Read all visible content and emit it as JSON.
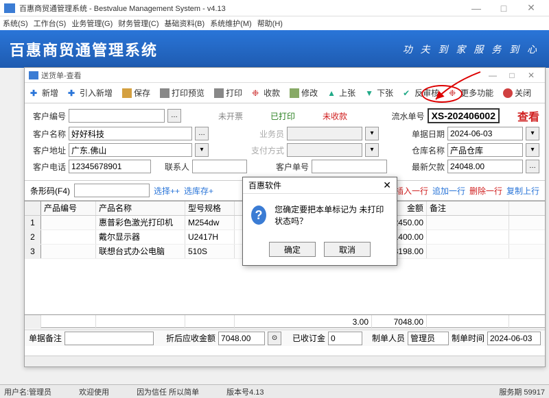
{
  "app": {
    "title": "百惠商贸通管理系统 - Bestvalue Management System - v4.13",
    "banner_title": "百惠商贸通管理系统",
    "slogan": "功 夫 到 家  服 务 到 心"
  },
  "menus": [
    "系统(S)",
    "工作台(S)",
    "业务管理(G)",
    "财务管理(C)",
    "基础资料(B)",
    "系统维护(M)",
    "帮助(H)"
  ],
  "subwin": {
    "title": "送货单-查看"
  },
  "toolbar": {
    "new": "新增",
    "import_new": "引入新增",
    "save": "保存",
    "preview": "打印预览",
    "print": "打印",
    "receive": "收款",
    "modify": "修改",
    "prev": "上张",
    "next": "下张",
    "unaudit": "反审核",
    "more": "更多功能",
    "close": "关闭"
  },
  "form": {
    "cust_code_lbl": "客户编号",
    "cust_code": "",
    "cust_name_lbl": "客户名称",
    "cust_name": "好好科技",
    "cust_addr_lbl": "客户地址",
    "cust_addr": "广东.佛山",
    "cust_tel_lbl": "客户电话",
    "cust_tel": "12345678901",
    "contact_lbl": "联系人",
    "contact": "",
    "tag_uninvoiced": "未开票",
    "tag_printed": "已打印",
    "tag_unpaid": "未收款",
    "salesman_lbl": "业务员",
    "paytype_lbl": "支付方式",
    "cust_order_lbl": "客户单号",
    "cust_order": "",
    "serial_lbl": "流水单号",
    "serial": "XS-202406002",
    "date_lbl": "单据日期",
    "date": "2024-06-03",
    "wh_lbl": "仓库名称",
    "wh": "产品仓库",
    "debt_lbl": "最新欠款",
    "debt": "24048.00",
    "view": "查看"
  },
  "barcode": {
    "label": "条形码(F4)",
    "select": "选择++",
    "select_stock": "选库存+",
    "insert": "插入一行",
    "append": "追加一行",
    "delete": "删除一行",
    "copy": "复制上行"
  },
  "grid": {
    "headers": [
      "",
      "产品编号",
      "产品名称",
      "型号规格",
      "",
      "金额",
      "备注"
    ],
    "rows": [
      {
        "idx": "1",
        "code": "",
        "name": "惠普彩色激光打印机",
        "spec": "M254dw",
        "amount": "2450.00",
        "note": ""
      },
      {
        "idx": "2",
        "code": "",
        "name": "戴尔显示器",
        "spec": "U2417H",
        "amount": "1400.00",
        "note": ""
      },
      {
        "idx": "3",
        "code": "",
        "name": "联想台式办公电脑",
        "spec": "510S",
        "amount": "3198.00",
        "note": ""
      }
    ],
    "totals": {
      "qty": "3.00",
      "amount": "7048.00"
    }
  },
  "footer": {
    "remark_lbl": "单据备注",
    "remark": "",
    "discount_lbl": "折后应收金额",
    "discount": "7048.00",
    "received_lbl": "已收订金",
    "received": "0",
    "maker_lbl": "制单人员",
    "maker": "管理员",
    "maketime_lbl": "制单时间",
    "maketime": "2024-06-03"
  },
  "dialog": {
    "title": "百惠软件",
    "message": "您确定要把本单标记为 未打印 状态吗？",
    "ok": "确定",
    "cancel": "取消"
  },
  "status": {
    "user_lbl": "用户名:",
    "user": "管理员",
    "welcome": "欢迎使用",
    "motto": "因为信任 所以简单",
    "ver_lbl": "版本号",
    "ver": "4.13",
    "svc_lbl": "服务期",
    "svc": "59917"
  }
}
